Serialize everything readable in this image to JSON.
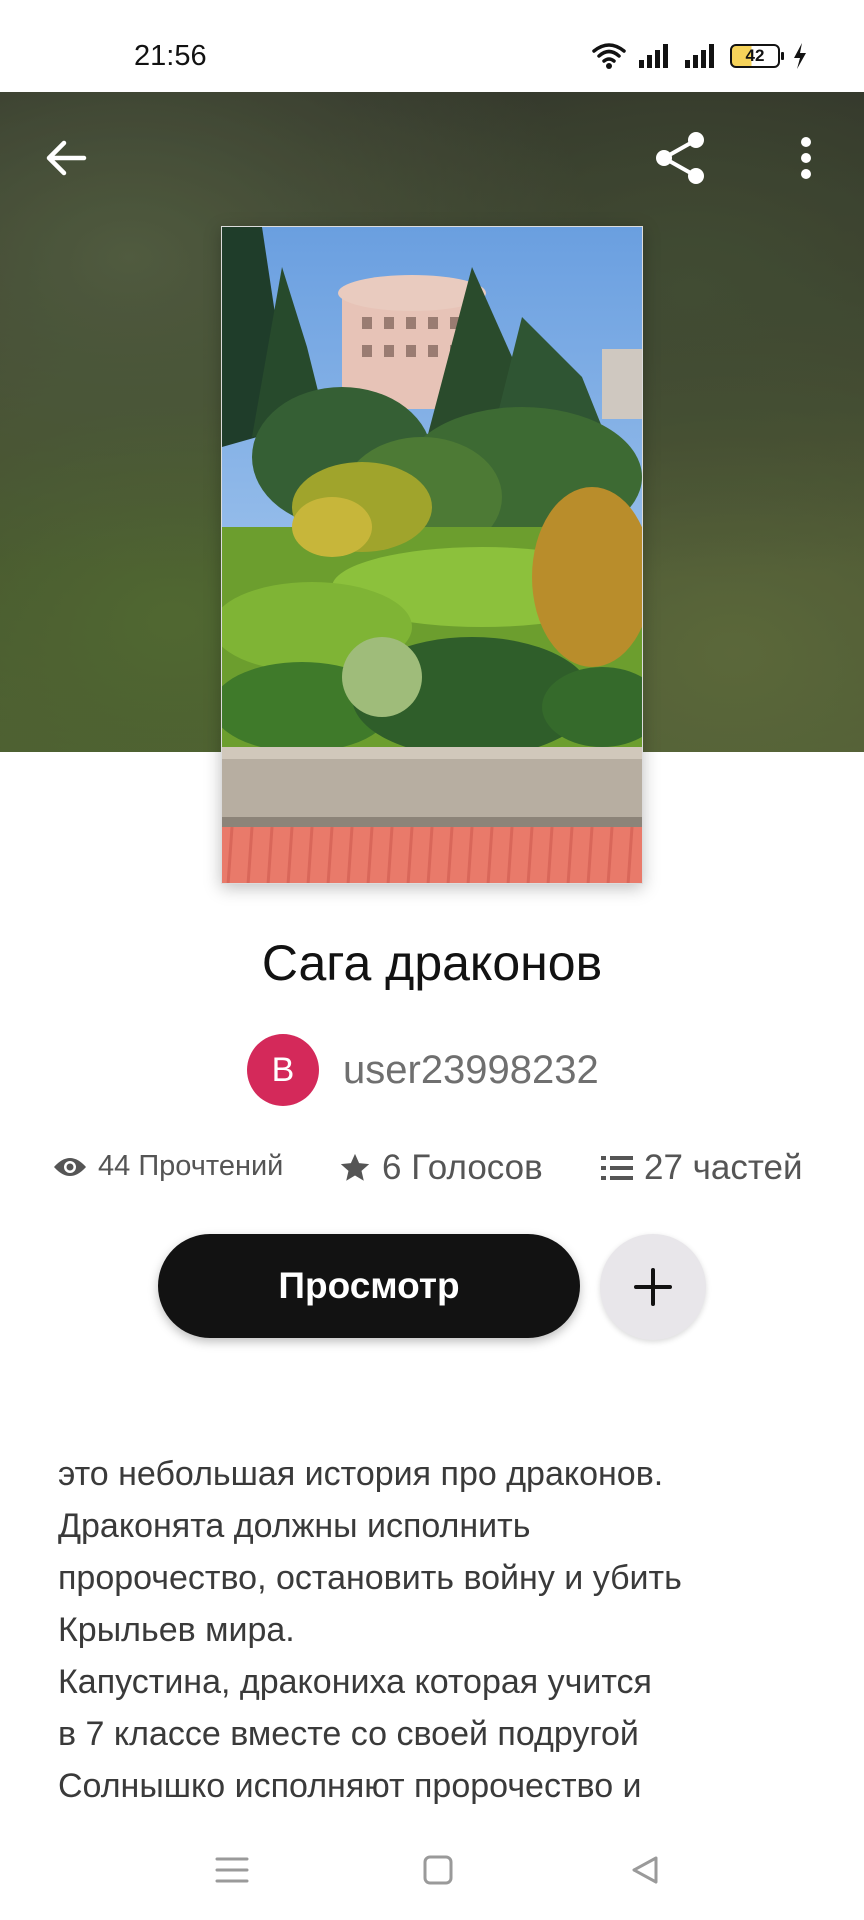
{
  "status_bar": {
    "time": "21:56",
    "battery_level": "42",
    "icons": [
      "wifi-icon",
      "signal-icon",
      "signal-icon",
      "battery-icon",
      "charging-icon"
    ]
  },
  "header": {
    "back_icon": "back-arrow-icon",
    "share_icon": "share-icon",
    "more_icon": "more-vertical-icon"
  },
  "story": {
    "title": "Сага драконов",
    "author": {
      "avatar_letter": "B",
      "avatar_color": "#d4295a",
      "name": "user23998232"
    },
    "stats": {
      "reads": "44 Прочтений",
      "votes": "6 Голосов",
      "parts": "27 частей"
    },
    "read_button_label": "Просмотр",
    "add_icon": "plus-icon",
    "description_lines": [
      "это небольшая история про драконов.",
      "Драконята должны исполнить",
      "пророчество, остановить войну и убить",
      "Крыльев мира.",
      "Капустина, дракониха которая учится",
      "в 7 классе вместе со своей подругой",
      "Солнышко исполняют пророчество и"
    ]
  },
  "nav_bar": {
    "icons": [
      "menu-icon",
      "home-square-icon",
      "back-triangle-icon"
    ]
  },
  "colors": {
    "primary_button": "#121212",
    "avatar": "#d4295a",
    "add_button": "#e8e6ea"
  }
}
